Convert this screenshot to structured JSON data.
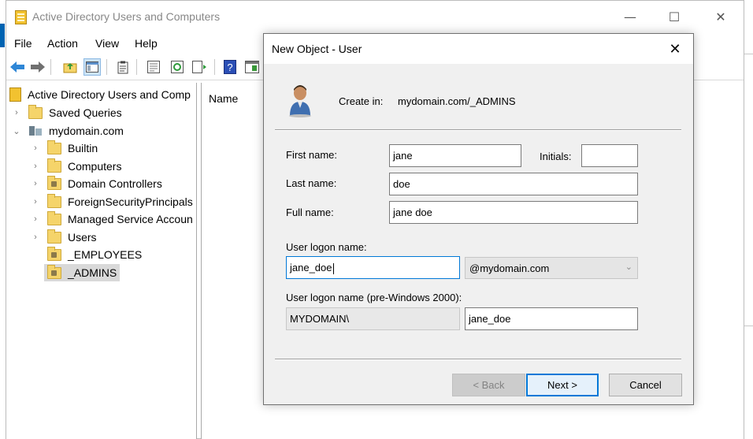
{
  "main_window": {
    "title": "Active Directory Users and Computers",
    "controls": {
      "minimize": "—",
      "maximize": "☐",
      "close": "✕"
    }
  },
  "menu": [
    "File",
    "Action",
    "View",
    "Help"
  ],
  "toolbar_icons": [
    "back-icon",
    "forward-icon",
    "up-folder-icon",
    "show-tree-icon",
    "clipboard-icon",
    "properties-icon",
    "refresh-icon",
    "export-icon",
    "help-icon",
    "console-icon"
  ],
  "tree": {
    "root": "Active Directory Users and Comp",
    "items": [
      {
        "label": "Saved Queries",
        "chevron": "›",
        "level": 1,
        "kind": "folder"
      },
      {
        "label": "mydomain.com",
        "chevron": "⌄",
        "level": 1,
        "kind": "domain"
      },
      {
        "label": "Builtin",
        "chevron": "›",
        "level": 2,
        "kind": "folder"
      },
      {
        "label": "Computers",
        "chevron": "›",
        "level": 2,
        "kind": "folder"
      },
      {
        "label": "Domain Controllers",
        "chevron": "›",
        "level": 2,
        "kind": "ou"
      },
      {
        "label": "ForeignSecurityPrincipals",
        "chevron": "›",
        "level": 2,
        "kind": "folder"
      },
      {
        "label": "Managed Service Accoun",
        "chevron": "›",
        "level": 2,
        "kind": "folder"
      },
      {
        "label": "Users",
        "chevron": "›",
        "level": 2,
        "kind": "folder"
      },
      {
        "label": "_EMPLOYEES",
        "chevron": "",
        "level": 2,
        "kind": "ou"
      },
      {
        "label": "_ADMINS",
        "chevron": "",
        "level": 2,
        "kind": "ou",
        "selected": true
      }
    ]
  },
  "list_pane": {
    "column_name": "Name"
  },
  "dialog": {
    "title": "New Object - User",
    "close": "✕",
    "create_in_label": "Create in:",
    "create_in_path": "mydomain.com/_ADMINS",
    "first_name_label": "First name:",
    "first_name_value": "jane",
    "initials_label": "Initials:",
    "initials_value": "",
    "last_name_label": "Last name:",
    "last_name_value": "doe",
    "full_name_label": "Full name:",
    "full_name_value": "jane doe",
    "logon_label": "User logon name:",
    "logon_value": "jane_doe",
    "domain_suffix": "@mydomain.com",
    "pre2000_label": "User logon name (pre-Windows 2000):",
    "pre2000_domain": "MYDOMAIN\\",
    "pre2000_value": "jane_doe",
    "back_button": "< Back",
    "next_button": "Next >",
    "cancel_button": "Cancel"
  },
  "colors": {
    "accent": "#0078d7",
    "folder": "#f5d46a",
    "selection": "#d9d9d9"
  }
}
